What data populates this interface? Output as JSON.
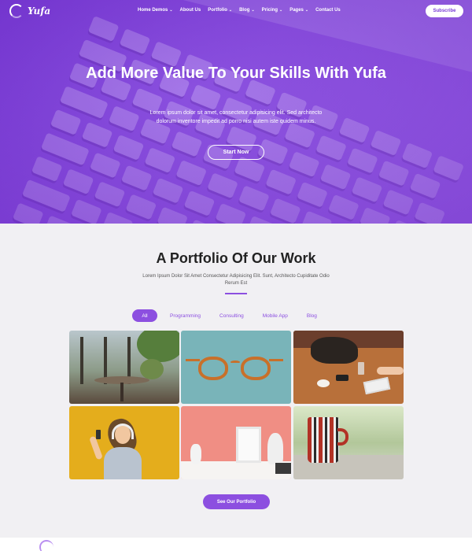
{
  "brand": {
    "name": "Yufa",
    "accent": "#8c4fe0"
  },
  "nav": {
    "items": [
      {
        "label": "Home Demos",
        "dropdown": true
      },
      {
        "label": "About Us",
        "dropdown": false
      },
      {
        "label": "Portfolio",
        "dropdown": true
      },
      {
        "label": "Blog",
        "dropdown": true
      },
      {
        "label": "Pricing",
        "dropdown": true
      },
      {
        "label": "Pages",
        "dropdown": true
      },
      {
        "label": "Contact Us",
        "dropdown": false
      }
    ],
    "subscribe": "Subscribe"
  },
  "hero": {
    "title": "Add More Value To Your Skills With Yufa",
    "text": "Lorem ipsum dolor sit amet, consectetur adipisicing elit. Sed architecto dolorum inventore impedit ad porro nisi autem iste quidem minus.",
    "button": "Start Now"
  },
  "portfolio": {
    "title": "A Portfolio Of Our Work",
    "subtitle": "Lorem Ipsum Dolor Sit Amet Consectetur Adipisicing Elit. Sunt, Architecto Cupiditate Odio Rerum Est",
    "filters": [
      "All",
      "Programming",
      "Consulting",
      "Mobile App",
      "Blog"
    ],
    "active_filter": "All",
    "button": "See Our Portfolio"
  }
}
